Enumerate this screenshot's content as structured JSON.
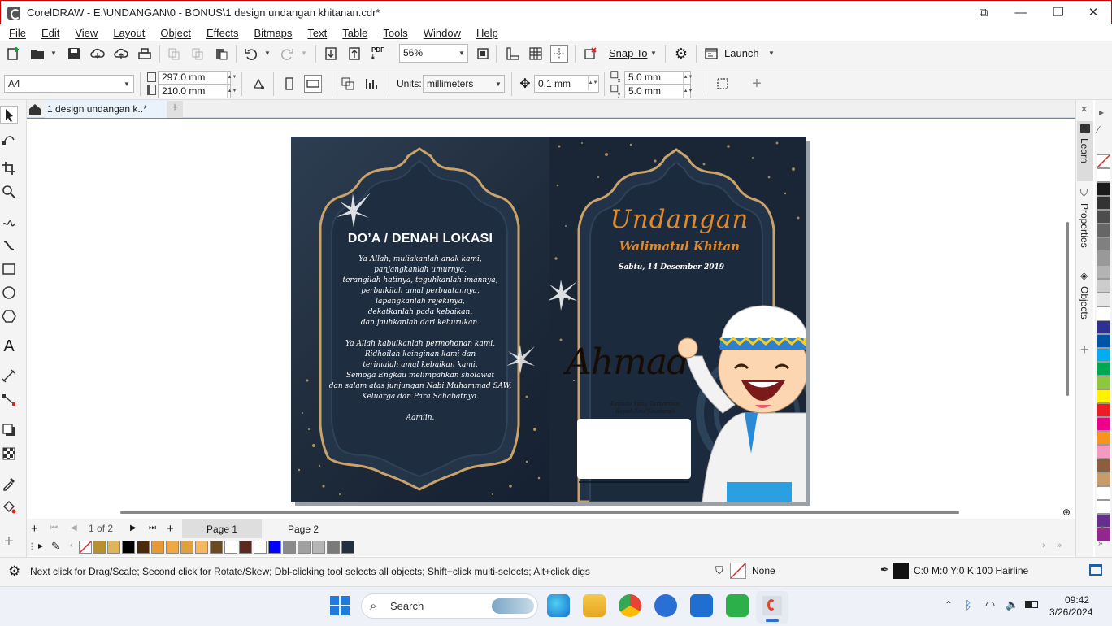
{
  "window": {
    "title": "CorelDRAW - E:\\UNDANGAN\\0 - BONUS\\1 design undangan khitanan.cdr*"
  },
  "menu": [
    "File",
    "Edit",
    "View",
    "Layout",
    "Object",
    "Effects",
    "Bitmaps",
    "Text",
    "Table",
    "Tools",
    "Window",
    "Help"
  ],
  "toolbar": {
    "zoom": "56%",
    "snap_label": "Snap To",
    "launch_label": "Launch"
  },
  "propbar": {
    "page_size": "A4",
    "width": "297.0 mm",
    "height": "210.0 mm",
    "units_label": "Units:",
    "units": "millimeters",
    "nudge": "0.1 mm",
    "dup_x": "5.0 mm",
    "dup_y": "5.0 mm"
  },
  "doc_tab": "1 design undangan k..*",
  "right_tabs": [
    "Learn",
    "Properties",
    "Objects"
  ],
  "pages": {
    "current": "1",
    "of_label": "of",
    "total": "2",
    "tabs": [
      "Page 1",
      "Page 2"
    ]
  },
  "design": {
    "left": {
      "heading": "DO’A / DENAH LOKASI",
      "lines": [
        "Ya Allah, muliakanlah anak kami,",
        "panjangkanlah umurnya,",
        "terangilah hatinya, teguhkanlah imannya,",
        "perbaikilah amal perbuatannya,",
        "lapangkanlah rejekinya,",
        "dekatkanlah pada kebaikan,",
        "dan jauhkanlah dari keburukan.",
        "",
        "Ya Allah kabulkanlah permohonan kami,",
        "Ridhoilah keinginan kami dan",
        "terimalah amal kebaikan kami.",
        "Semoga Engkau melimpahkan sholawat",
        "dan salam atas junjungan Nabi Muhammad SAW,",
        "Keluarga dan Para Sahabatnya.",
        "",
        "Aamiin."
      ]
    },
    "right": {
      "title": "Undangan",
      "subtitle": "Walimatul Khitan",
      "date": "Sabtu, 14 Desember 2019",
      "name": "Ahmad",
      "to1": "Kepada Yang Terhormat",
      "to2": "Bapak/Ibu/Saudara/i"
    }
  },
  "status": {
    "hint": "Next click for Drag/Scale; Second click for Rotate/Skew; Dbl-clicking tool selects all objects; Shift+click multi-selects; Alt+click digs",
    "fill": "None",
    "outline": "C:0 M:0 Y:0 K:100  Hairline"
  },
  "taskbar": {
    "search": "Search",
    "time": "09:42",
    "date": "3/26/2024"
  },
  "colors": {
    "accent": "#2a6fd6",
    "page_dark": "#1f2c3c",
    "gold": "#c9a36a",
    "orange": "#e08a2e"
  },
  "palette": [
    "#ffffff",
    "#1a1a1a",
    "#333333",
    "#4d4d4d",
    "#666666",
    "#808080",
    "#999999",
    "#b3b3b3",
    "#cccccc",
    "#e6e6e6",
    "#ffffff",
    "#2e3192",
    "#0054a6",
    "#00aeef",
    "#00a651",
    "#8dc63f",
    "#fff200",
    "#ed1c24",
    "#ec008c",
    "#f7941d",
    "#f49ac1",
    "#8b5e3c",
    "#c69c6d",
    "#ffffff",
    "#ffffff",
    "#662d91",
    "#92278f"
  ],
  "doc_palette": [
    "#b8912e",
    "#e0b45a",
    "#000000",
    "#4a2a0a",
    "#e89a2e",
    "#f0a845",
    "#e0a040",
    "#f3b860",
    "#6b4a20",
    "#ffffff",
    "#5a2a20",
    "#ffffff",
    "#0000ff",
    "#8a8a8a",
    "#a0a0a0",
    "#b5b5b5",
    "#7a7a7a",
    "#22303f"
  ]
}
